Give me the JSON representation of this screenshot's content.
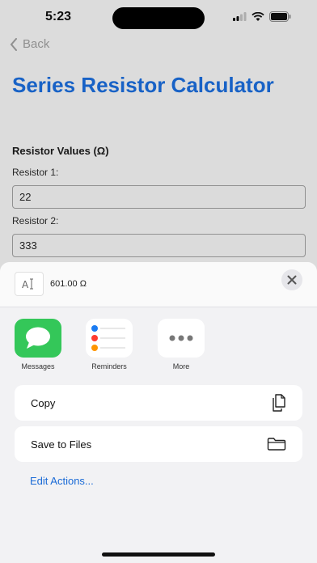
{
  "status_bar": {
    "time": "5:23"
  },
  "nav": {
    "back_label": "Back"
  },
  "page": {
    "title": "Series Resistor Calculator",
    "section_label": "Resistor Values (Ω)",
    "fields": [
      {
        "label": "Resistor 1:",
        "value": "22"
      },
      {
        "label": "Resistor 2:",
        "value": "333"
      }
    ]
  },
  "share_sheet": {
    "preview_text": "601.00 Ω",
    "apps": [
      {
        "label": "Messages",
        "icon": "messages-icon"
      },
      {
        "label": "Reminders",
        "icon": "reminders-icon"
      },
      {
        "label": "More",
        "icon": "more-icon"
      }
    ],
    "actions": [
      {
        "label": "Copy",
        "icon": "copy-icon"
      },
      {
        "label": "Save to Files",
        "icon": "folder-icon"
      }
    ],
    "edit_actions_label": "Edit Actions..."
  },
  "colors": {
    "accent": "#1a6ad6",
    "messages_green": "#34c759"
  }
}
